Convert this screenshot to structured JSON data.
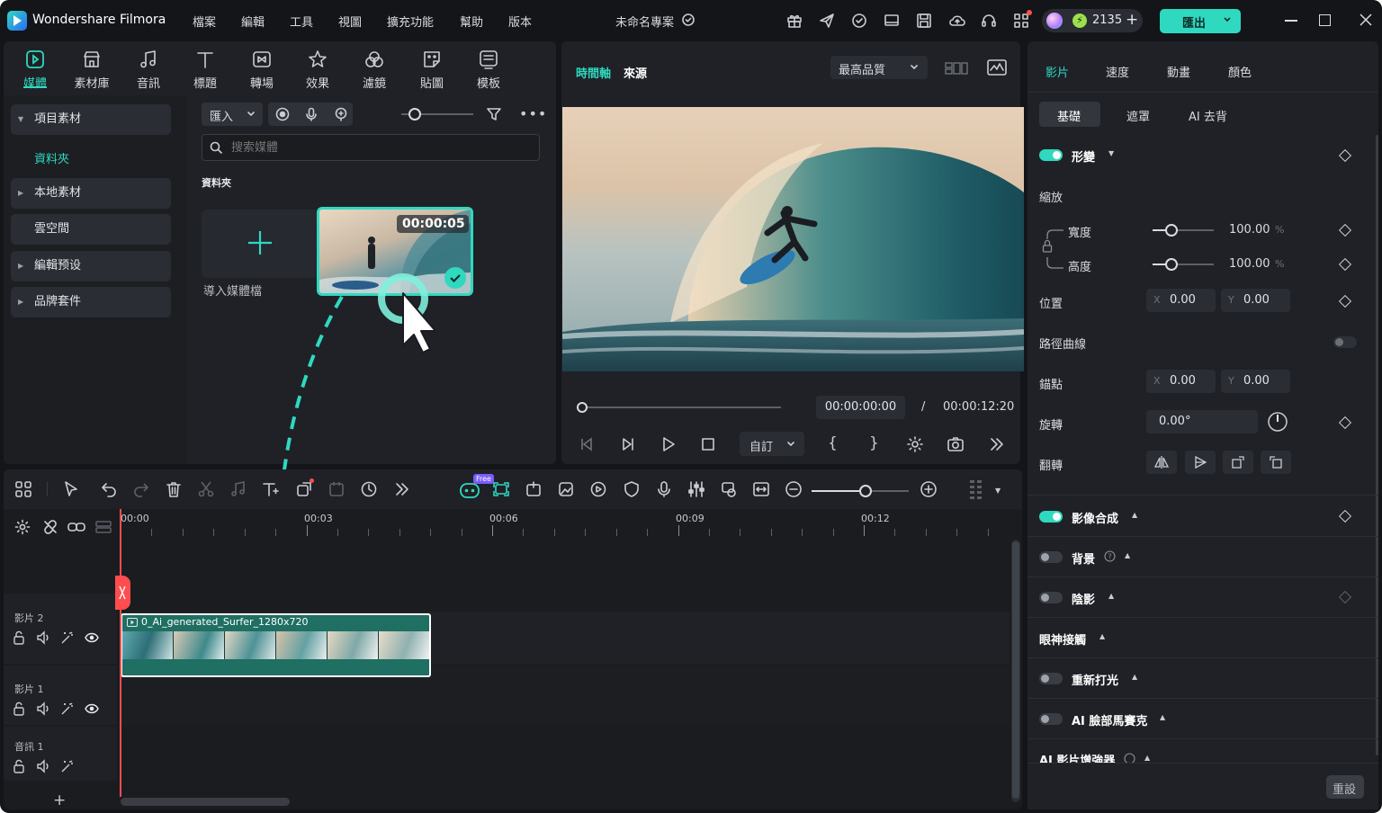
{
  "app": {
    "name": "Wondershare Filmora",
    "project_title": "未命名專案"
  },
  "menu": [
    "檔案",
    "編輯",
    "工具",
    "視圖",
    "擴充功能",
    "幫助",
    "版本"
  ],
  "credits": "2135",
  "export_label": "匯出",
  "toolbar": [
    {
      "label": "媒體",
      "icon": "media-icon",
      "active": true
    },
    {
      "label": "素材庫",
      "icon": "stock-icon"
    },
    {
      "label": "音訊",
      "icon": "music-note-icon"
    },
    {
      "label": "標題",
      "icon": "text-t-icon"
    },
    {
      "label": "轉場",
      "icon": "transition-icon"
    },
    {
      "label": "效果",
      "icon": "effects-star-icon"
    },
    {
      "label": "濾鏡",
      "icon": "filter-icon"
    },
    {
      "label": "貼圖",
      "icon": "sticker-icon"
    },
    {
      "label": "模板",
      "icon": "template-icon"
    }
  ],
  "sidebar": {
    "items": [
      {
        "label": "項目素材",
        "expanded": true
      },
      {
        "label": "資料夾",
        "selected": true
      },
      {
        "label": "本地素材"
      },
      {
        "label": "雲空間"
      },
      {
        "label": "編輯预设"
      },
      {
        "label": "品牌套件"
      }
    ]
  },
  "media": {
    "import_label": "匯入",
    "search_placeholder": "搜索媒體",
    "folder_label": "資料夾",
    "import_media_label": "導入媒體檔",
    "clip_duration": "00:00:05"
  },
  "preview": {
    "tab_timeline": "時間軸",
    "tab_source": "來源",
    "quality": "最高品質",
    "current_time": "00:00:00:00",
    "separator": "/",
    "total_time": "00:00:12:20",
    "custom_label": "自訂"
  },
  "timeline": {
    "ruler": [
      "00:00",
      "00:03",
      "00:06",
      "00:09",
      "00:12"
    ],
    "tracks": [
      "影片 2",
      "影片 1",
      "音訊 1"
    ],
    "clip_name": "0_Ai_generated_Surfer_1280x720",
    "free_badge": "Free"
  },
  "inspector": {
    "tabs": [
      "影片",
      "速度",
      "動畫",
      "顏色"
    ],
    "subtabs": [
      "基礎",
      "遮罩",
      "AI 去背"
    ],
    "transform": "形變",
    "scale": "縮放",
    "width": "寬度",
    "height": "高度",
    "scale_width_value": "100.00",
    "scale_height_value": "100.00",
    "percent": "%",
    "position": "位置",
    "pos_x": "0.00",
    "pos_y": "0.00",
    "path_curve": "路徑曲線",
    "anchor": "錨點",
    "anchor_x": "0.00",
    "anchor_y": "0.00",
    "rotate": "旋轉",
    "rotate_value": "0.00°",
    "flip": "翻轉",
    "compositing": "影像合成",
    "background": "背景",
    "shadow": "陰影",
    "eye_contact": "眼神接觸",
    "relight": "重新打光",
    "face_mosaic": "AI 臉部馬賽克",
    "ai_enhancer": "AI 影片增強器",
    "reset": "重設",
    "x_label": "X",
    "y_label": "Y"
  },
  "colors": {
    "accent": "#2fd9c0",
    "panel": "#1f2126",
    "bg": "#131519",
    "clip": "#1f6f63",
    "playhead": "#ff4d4f"
  }
}
